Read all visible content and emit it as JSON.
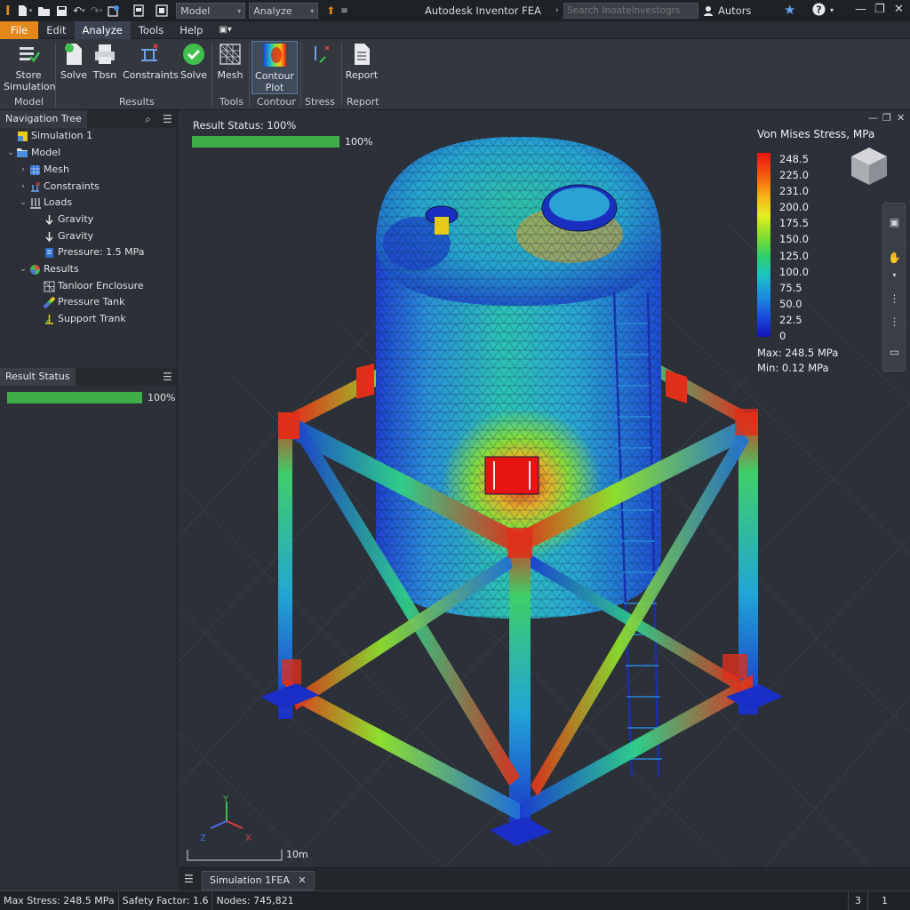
{
  "titlebar": {
    "model_dropdown": "Model",
    "analyze_dropdown": "Analyze",
    "app_title": "Autodesk Inventor FEA",
    "search_placeholder": "Search Inoatelnvestogrs",
    "user": "Autors"
  },
  "menu": [
    "File",
    "Edit",
    "Analyze",
    "Tools",
    "Help"
  ],
  "ribbon": {
    "buttons": {
      "store_simulation": "Store\nSimulation",
      "solve1": "Solve",
      "tbsn": "Tbsn",
      "constraints": "Constraints",
      "solve2": "Solve",
      "mesh": "Mesh",
      "contour_plot": "Contour\nPlot",
      "report": "Report"
    },
    "groups": {
      "model": "Model",
      "results": "Results",
      "tools": "Tools",
      "contour": "Contour",
      "stress": "Stress",
      "report": "Report"
    }
  },
  "nav_tree": {
    "title": "Navigation Tree",
    "items": [
      {
        "label": "Simulation 1",
        "icon": "simulation-icon"
      },
      {
        "label": "Model",
        "icon": "folder-icon"
      },
      {
        "label": "Mesh",
        "icon": "mesh-icon"
      },
      {
        "label": "Constraints",
        "icon": "constraints-icon"
      },
      {
        "label": "Loads",
        "icon": "loads-icon"
      },
      {
        "label": "Gravity",
        "icon": "gravity-icon"
      },
      {
        "label": "Gravity",
        "icon": "gravity-icon"
      },
      {
        "label": "Pressure: 1.5 MPa",
        "icon": "pressure-icon"
      },
      {
        "label": "Results",
        "icon": "results-icon"
      },
      {
        "label": "Tanloor Enclosure",
        "icon": "mesh-result-icon"
      },
      {
        "label": "Pressure Tank",
        "icon": "stress-result-icon"
      },
      {
        "label": "Support Trank",
        "icon": "support-icon"
      }
    ]
  },
  "result_status_panel": {
    "title": "Result Status",
    "progress": 1.0,
    "progress_label": "100%"
  },
  "viewport": {
    "result_status_label": "Result Status: 100%",
    "progress": 1.0,
    "progress_label": "100%",
    "legend": {
      "title": "Von Mises Stress, MPa",
      "ticks": [
        "248.5",
        "225.0",
        "231.0",
        "200.0",
        "175.5",
        "150.0",
        "125.0",
        "100.0",
        "75.5",
        "50.0",
        "22.5",
        "0"
      ],
      "max": "Max: 248.5 MPa",
      "min": "Min: 0.12 MPa"
    },
    "axes": {
      "y": "Y",
      "x": "X",
      "z": "Z"
    },
    "scale_label": "10m"
  },
  "doc_tab": "Simulation 1FEA",
  "statusbar": {
    "max_stress": "Max Stress: 248.5 MPa",
    "safety_factor": "Safety Factor: 1.6",
    "nodes": "Nodes: 745,821",
    "right1": "3",
    "right2": "1"
  },
  "colors": {
    "accent_orange": "#e3871b",
    "progress_green": "#3fae49",
    "stress_high": "#e8140f",
    "stress_low": "#1512b8"
  }
}
